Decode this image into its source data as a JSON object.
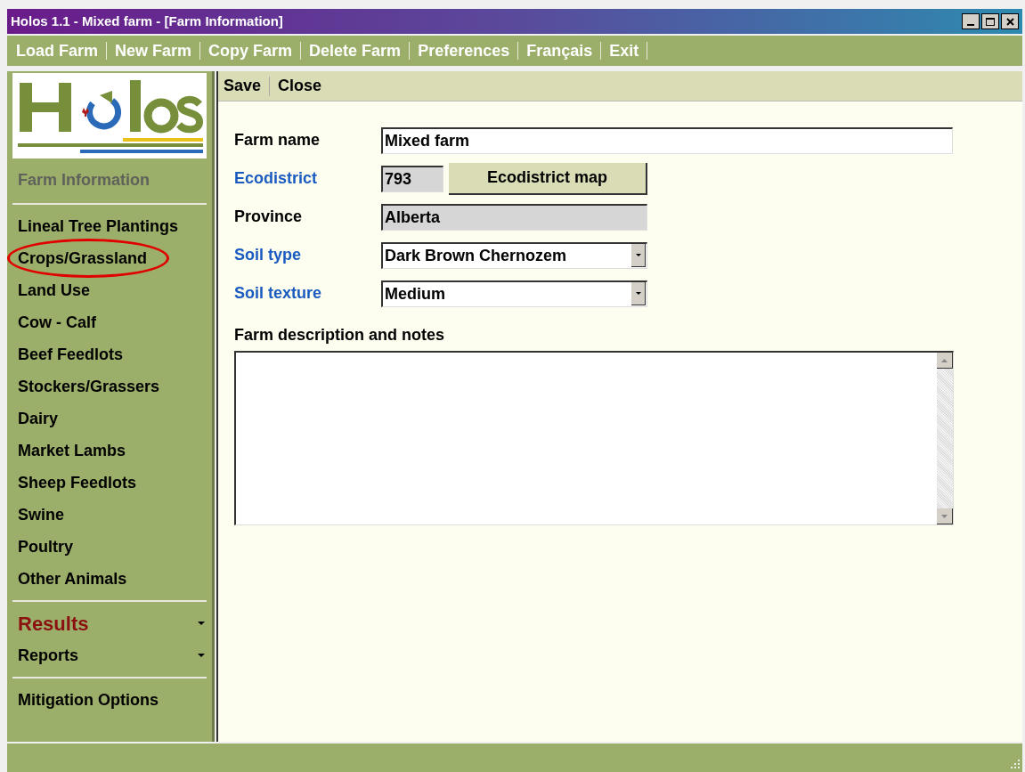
{
  "window": {
    "title": "Holos 1.1 - Mixed farm - [Farm Information]"
  },
  "menu": [
    "Load Farm",
    "New Farm",
    "Copy Farm",
    "Delete Farm",
    "Preferences",
    "Français",
    "Exit"
  ],
  "sidebar": {
    "items": [
      {
        "label": "Farm Information",
        "kind": "link",
        "selected": true,
        "circled": false
      },
      {
        "kind": "divider"
      },
      {
        "label": "Lineal Tree Plantings",
        "kind": "link",
        "selected": false,
        "circled": false
      },
      {
        "label": "Crops/Grassland",
        "kind": "link",
        "selected": false,
        "circled": true
      },
      {
        "label": "Land Use",
        "kind": "link",
        "selected": false,
        "circled": false
      },
      {
        "label": "Cow - Calf",
        "kind": "link",
        "selected": false,
        "circled": false
      },
      {
        "label": "Beef Feedlots",
        "kind": "link",
        "selected": false,
        "circled": false
      },
      {
        "label": "Stockers/Grassers",
        "kind": "link",
        "selected": false,
        "circled": false
      },
      {
        "label": "Dairy",
        "kind": "link",
        "selected": false,
        "circled": false
      },
      {
        "label": "Market Lambs",
        "kind": "link",
        "selected": false,
        "circled": false
      },
      {
        "label": "Sheep Feedlots",
        "kind": "link",
        "selected": false,
        "circled": false
      },
      {
        "label": "Swine",
        "kind": "link",
        "selected": false,
        "circled": false
      },
      {
        "label": "Poultry",
        "kind": "link",
        "selected": false,
        "circled": false
      },
      {
        "label": "Other Animals",
        "kind": "link",
        "selected": false,
        "circled": false
      },
      {
        "kind": "divider"
      },
      {
        "label": "Results",
        "kind": "header_menu",
        "selected": false,
        "circled": false
      },
      {
        "label": "Reports",
        "kind": "menu",
        "selected": false,
        "circled": false
      },
      {
        "kind": "divider"
      },
      {
        "label": "Mitigation Options",
        "kind": "link",
        "selected": false,
        "circled": false
      }
    ]
  },
  "toolbar": [
    "Save",
    "Close"
  ],
  "form": {
    "fields": [
      {
        "label": "Farm name",
        "link": false,
        "kind": "text",
        "value": "Mixed farm"
      },
      {
        "label": "Ecodistrict",
        "link": true,
        "kind": "readonly_button",
        "value": "793",
        "button": "Ecodistrict map"
      },
      {
        "label": "Province",
        "link": false,
        "kind": "readonly",
        "value": "Alberta"
      },
      {
        "label": "Soil type",
        "link": true,
        "kind": "select",
        "value": "Dark Brown Chernozem"
      },
      {
        "label": "Soil texture",
        "link": true,
        "kind": "select",
        "value": "Medium"
      }
    ],
    "notes": {
      "label": "Farm description and notes"
    }
  }
}
